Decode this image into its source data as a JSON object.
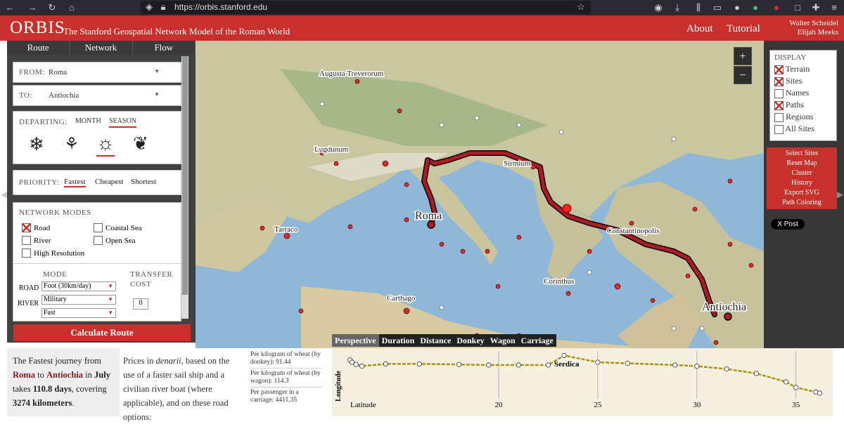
{
  "browser": {
    "url": "https://orbis.stanford.edu"
  },
  "header": {
    "logo": "ORBIS",
    "subtitle": "The Stanford Geospatial Network Model of the Roman World",
    "nav": [
      "About",
      "Tutorial"
    ],
    "authors": [
      "Walter Scheidel",
      "Elijah Meeks"
    ]
  },
  "sidebar": {
    "tabs": [
      "Route",
      "Network",
      "Flow"
    ],
    "from_label": "FROM:",
    "from_value": "Roma",
    "to_label": "TO:",
    "to_value": "Antiochia",
    "departing_label": "DEPARTING:",
    "month_label": "MONTH",
    "season_label": "SEASON",
    "priority_label": "PRIORITY:",
    "priorities": [
      "Fastest",
      "Cheapest",
      "Shortest"
    ],
    "network_modes_label": "NETWORK MODES",
    "modes": [
      {
        "label": "Road",
        "checked": true
      },
      {
        "label": "Coastal Sea",
        "checked": false
      },
      {
        "label": "River",
        "checked": false
      },
      {
        "label": "Open Sea",
        "checked": false
      },
      {
        "label": "High Resolution",
        "checked": false
      }
    ],
    "mode_header": "MODE",
    "transfer_header": "TRANSFER",
    "cost_header": "COST",
    "road_label": "ROAD",
    "road_mode": "Foot (30km/day)",
    "river_label": "RIVER",
    "river_mode": "Military",
    "third_mode": "Fast",
    "transfer_value": "0",
    "calculate_label": "Calculate Route"
  },
  "map": {
    "labels": [
      {
        "name": "Augusta Treverorum"
      },
      {
        "name": "Lugdunum"
      },
      {
        "name": "Sirmium"
      },
      {
        "name": "Roma"
      },
      {
        "name": "Tarraco"
      },
      {
        "name": "Constantinopolis"
      },
      {
        "name": "Corinthus"
      },
      {
        "name": "Carthago"
      },
      {
        "name": "Antiochia"
      }
    ],
    "zoom_in": "+",
    "zoom_out": "−"
  },
  "display": {
    "title": "DISPLAY",
    "items": [
      {
        "label": "Terrain",
        "checked": true
      },
      {
        "label": "Sites",
        "checked": true
      },
      {
        "label": "Names",
        "checked": false
      },
      {
        "label": "Paths",
        "checked": true
      },
      {
        "label": "Regions",
        "checked": false
      },
      {
        "label": "All Sites",
        "checked": false
      }
    ],
    "menu": [
      "Select Sites",
      "Reset Map",
      "Cluster",
      "History",
      "Export SVG",
      "Path Coloring"
    ],
    "xpost": "X Post"
  },
  "summary": {
    "line1": "The Fastest journey from",
    "from": "Roma",
    "to_word": "to",
    "to": "Antiochia",
    "in_word": "in",
    "month": "July",
    "takes": "takes",
    "days": "110.8 days",
    "covering": ", covering",
    "km": "3274 kilometers",
    "end": "."
  },
  "prices": {
    "text1": "Prices in",
    "denarii": "denarii",
    "text2": ", based on the use of a faster sail ship and a civilian river boat (where applicable), and on these road options:",
    "donkey": "Per kilogram of wheat (by donkey): 91.44",
    "wagon": "Per kilogram of wheat (by wagon): 114.3",
    "carriage": "Per passenger in a carriage: 4411.35"
  },
  "chart": {
    "tabs": [
      "Perspective",
      "Duration",
      "Distance",
      "Donkey",
      "Wagon",
      "Carriage"
    ],
    "ylabel": "Longitude",
    "xlabel": "Latitude",
    "ticks": [
      "20",
      "25",
      "30",
      "35"
    ],
    "annotation": "Serdica"
  },
  "chart_data": {
    "type": "line",
    "title": "",
    "xlabel": "Latitude",
    "ylabel": "Longitude",
    "x_ticks": [
      20,
      25,
      30,
      35
    ],
    "points": [
      [
        12.5,
        41.9
      ],
      [
        12.6,
        41.5
      ],
      [
        12.8,
        41.1
      ],
      [
        13.1,
        40.8
      ],
      [
        14.3,
        41.2
      ],
      [
        16.0,
        41.2
      ],
      [
        18.0,
        41.1
      ],
      [
        19.5,
        41.0
      ],
      [
        21.0,
        41.0
      ],
      [
        22.5,
        41.0
      ],
      [
        23.3,
        42.7
      ],
      [
        25.0,
        41.5
      ],
      [
        26.5,
        41.3
      ],
      [
        28.9,
        41.0
      ],
      [
        30.0,
        40.8
      ],
      [
        31.5,
        40.3
      ],
      [
        33.0,
        39.5
      ],
      [
        34.5,
        38.0
      ],
      [
        35.0,
        37.0
      ],
      [
        36.0,
        36.2
      ],
      [
        36.2,
        36.0
      ]
    ]
  }
}
